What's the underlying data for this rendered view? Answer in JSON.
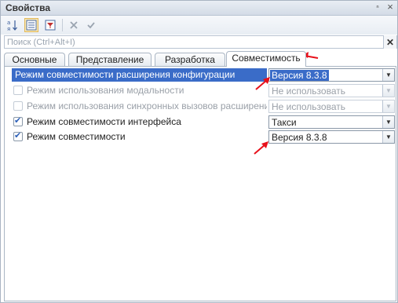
{
  "window": {
    "title": "Свойства",
    "pin_glyph": "ⁿ",
    "close_glyph": "×"
  },
  "toolbar": {
    "sort_icon": "sort-az-icon",
    "categories_icon": "categories-icon",
    "filter_icon": "filter-icon",
    "delete_icon": "delete-icon",
    "apply_icon": "apply-icon"
  },
  "search": {
    "placeholder": "Поиск (Ctrl+Alt+I)",
    "clear_glyph": "✕"
  },
  "tabs": [
    {
      "label": "Основные"
    },
    {
      "label": "Представление"
    },
    {
      "label": "Разработка"
    },
    {
      "label": "Совместимость"
    }
  ],
  "properties": [
    {
      "label": "Режим совместимости расширения конфигурации",
      "value": "Версия 8.3.8",
      "checkbox": "none",
      "enabled": true
    },
    {
      "label": "Режим использования модальности",
      "value": "Не использовать",
      "checkbox": "unchecked",
      "enabled": false
    },
    {
      "label": "Режим использования синхронных вызовов расширений пл",
      "value": "Не использовать",
      "checkbox": "unchecked",
      "enabled": false
    },
    {
      "label": "Режим совместимости интерфейса",
      "value": "Такси",
      "checkbox": "checked",
      "enabled": true
    },
    {
      "label": "Режим совместимости",
      "value": "Версия 8.3.8",
      "checkbox": "checked",
      "enabled": true
    }
  ],
  "annotation_color": "#e8101a",
  "selection_color": "#3a6cc8"
}
